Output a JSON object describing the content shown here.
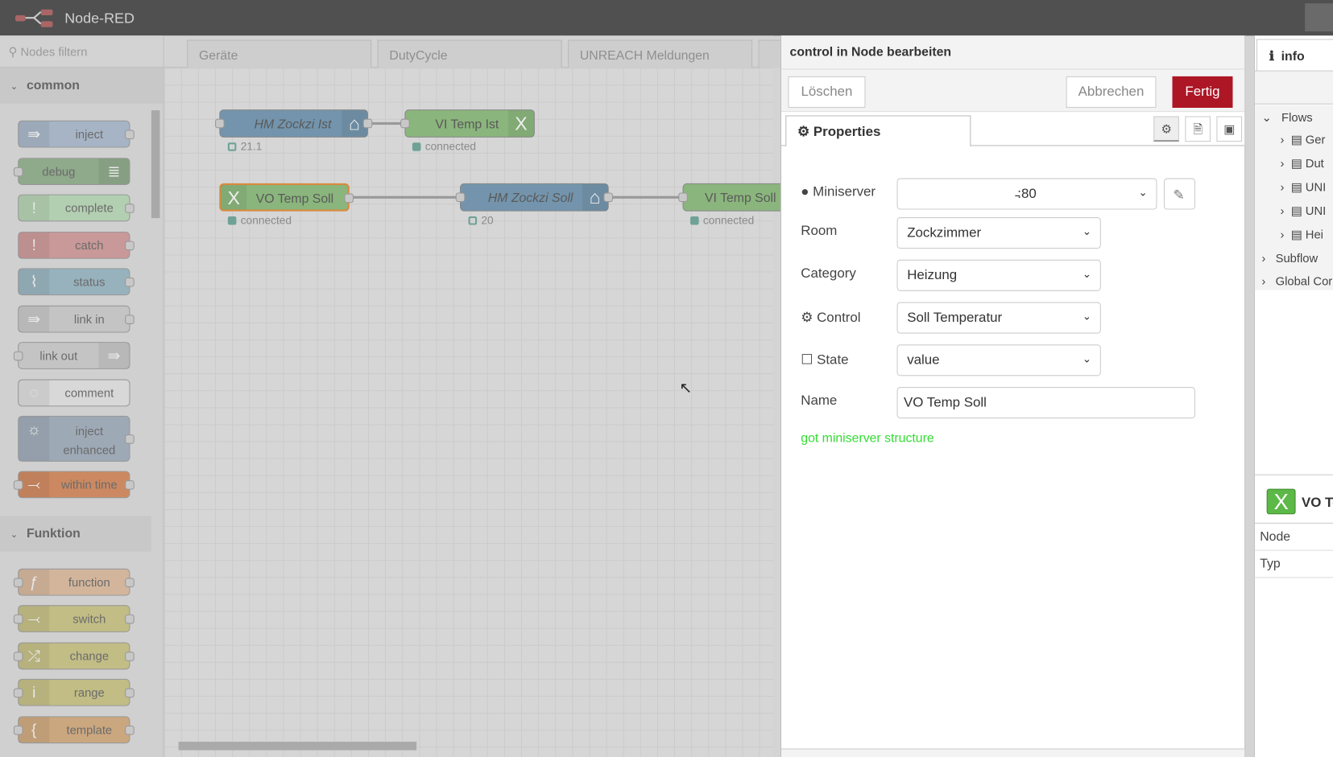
{
  "header": {
    "title": "Node-RED"
  },
  "palette": {
    "filter_placeholder": "Nodes filtern",
    "categories": [
      {
        "label": "common"
      },
      {
        "label": "Funktion"
      }
    ],
    "common": [
      {
        "label": "inject",
        "color": "#a6b4c5",
        "icon": "⇛"
      },
      {
        "label": "debug",
        "color": "#8fa98b",
        "icon": "≣"
      },
      {
        "label": "complete",
        "color": "#b3cfb1",
        "icon": "!"
      },
      {
        "label": "catch",
        "color": "#c99898",
        "icon": "!"
      },
      {
        "label": "status",
        "color": "#97b2bd",
        "icon": "⌇"
      },
      {
        "label": "link in",
        "color": "#c4c4c4",
        "icon": "⇛"
      },
      {
        "label": "link out",
        "color": "#c4c4c4",
        "icon": "⇛"
      },
      {
        "label": "comment",
        "color": "#d8d8d8",
        "icon": "◌"
      },
      {
        "label": "inject enhanced",
        "color": "#9ea9b6",
        "icon": "☼"
      },
      {
        "label": "within time",
        "color": "#cc8961",
        "icon": "⤙"
      }
    ],
    "funktion": [
      {
        "label": "function",
        "color": "#d3b59c",
        "icon": "ƒ"
      },
      {
        "label": "switch",
        "color": "#c2bd85",
        "icon": "⤙"
      },
      {
        "label": "change",
        "color": "#c2bd85",
        "icon": "⤮"
      },
      {
        "label": "range",
        "color": "#c2bd85",
        "icon": "i"
      },
      {
        "label": "template",
        "color": "#cba77f",
        "icon": "{"
      }
    ]
  },
  "workspace": {
    "tabs": [
      "Geräte",
      "DutyCycle",
      "UNREACH Meldungen"
    ],
    "nodes": [
      {
        "label": "HM Zockzi Ist",
        "status": "21.1"
      },
      {
        "label": "VI Temp Ist",
        "status": "connected"
      },
      {
        "label": "VO Temp Soll",
        "status": "connected"
      },
      {
        "label": "HM Zockzi Soll",
        "status": "20"
      },
      {
        "label": "VI Temp Soll",
        "status": "connected"
      }
    ]
  },
  "dialog": {
    "title": "control in Node bearbeiten",
    "delete": "Löschen",
    "cancel": "Abbrechen",
    "done": "Fertig",
    "done_color": "#ad1625",
    "tab": "Properties",
    "fields": {
      "miniserver_label": "Miniserver",
      "miniserver_value": "̵:80",
      "room_label": "Room",
      "room_value": "Zockzimmer",
      "category_label": "Category",
      "category_value": "Heizung",
      "control_label": "Control",
      "control_value": "Soll Temperatur",
      "state_label": "State",
      "state_value": "value",
      "name_label": "Name",
      "name_value": "VO Temp Soll"
    },
    "status_message": "got miniserver structure"
  },
  "sidebar": {
    "tab": "info",
    "flows_label": "Flows",
    "flows": [
      "Ger",
      "Dut",
      "UNI",
      "UNI",
      "Hei"
    ],
    "subflow": "Subflow",
    "global": "Global Cor",
    "node_name": "VO Te",
    "props": [
      "Node",
      "Typ"
    ]
  }
}
